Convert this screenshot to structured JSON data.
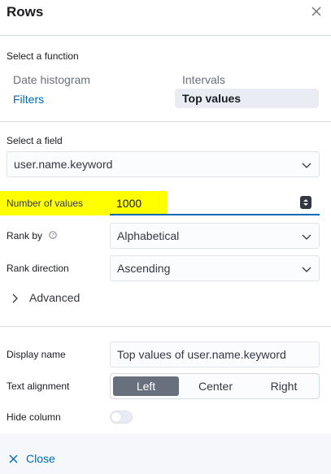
{
  "panel": {
    "title": "Rows"
  },
  "function_section": {
    "label": "Select a function",
    "options": [
      {
        "label": "Date histogram",
        "selected": false,
        "style": "plain"
      },
      {
        "label": "Intervals",
        "selected": false,
        "style": "plain"
      },
      {
        "label": "Filters",
        "selected": false,
        "style": "link"
      },
      {
        "label": "Top values",
        "selected": true,
        "style": "selected"
      }
    ]
  },
  "field_section": {
    "label": "Select a field",
    "value": "user.name.keyword",
    "icon": "chevron-down-icon"
  },
  "number_of_values": {
    "label": "Number of values",
    "value": "1000",
    "highlight_color": "#ffff00"
  },
  "rank_by": {
    "label": "Rank by",
    "value": "Alphabetical",
    "help_icon": "question-circle-icon"
  },
  "rank_direction": {
    "label": "Rank direction",
    "value": "Ascending"
  },
  "advanced": {
    "label": "Advanced",
    "icon": "chevron-right-icon"
  },
  "display_name": {
    "label": "Display name",
    "value": "Top values of user.name.keyword"
  },
  "text_alignment": {
    "label": "Text alignment",
    "options": [
      "Left",
      "Center",
      "Right"
    ],
    "selected": "Left"
  },
  "hide_column": {
    "label": "Hide column",
    "enabled": false
  },
  "footer": {
    "close_label": "Close"
  },
  "colors": {
    "link": "#006bb4",
    "highlight": "#ffff00",
    "active_segment": "#69707d"
  }
}
